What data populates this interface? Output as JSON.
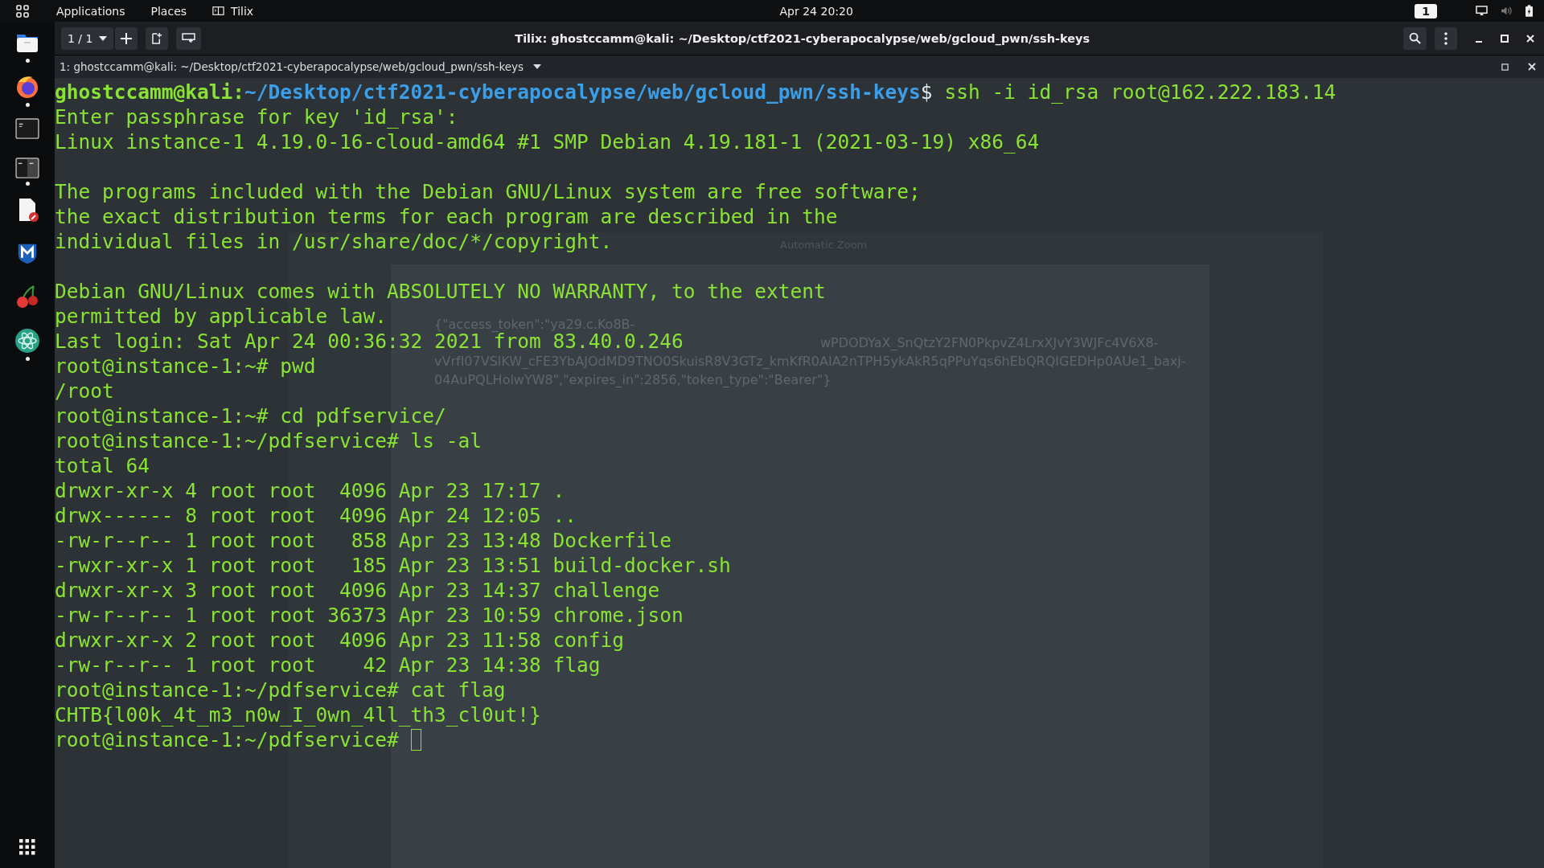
{
  "top_bar": {
    "menus": [
      "Applications",
      "Places",
      "Tilix"
    ],
    "clock": "Apr 24  20:20",
    "workspace": "1"
  },
  "window": {
    "session": "1 / 1",
    "title": "Tilix: ghostccamm@kali: ~/Desktop/ctf2021-cyberapocalypse/web/gcloud_pwn/ssh-keys"
  },
  "tab": {
    "label": "1: ghostccamm@kali: ~/Desktop/ctf2021-cyberapocalypse/web/gcloud_pwn/ssh-keys"
  },
  "background_viewer": {
    "zoom": "Automatic Zoom",
    "lines": [
      {
        "text": "{\"access_token\":\"ya29.c.Ko8B-"
      },
      {
        "text": "wPDODYaX_SnQtzY2FN0PkpvZ4LrxXJvY3WJFc4V6X8-"
      },
      {
        "text": "vVrfI07VSlKW_cFE3YbAJOdMD9TNO0SkuisR8V3GTz_kmKfR0AIA2nTPH5ykAkR5qPPuYqs6hEbQRQIGEDHp0AUe1_baxj-"
      },
      {
        "text": "04AuPQLHolwYW8\",\"expires_in\":2856,\"token_type\":\"Bearer\"}"
      }
    ]
  },
  "terminal": {
    "lines": [
      {
        "kind": "host_prompt",
        "user": "ghostccamm@kali:",
        "path": "~/Desktop/ctf2021-cyberapocalypse/web/gcloud_pwn/ssh-keys",
        "symbol": "$",
        "command": "ssh -i id_rsa root@162.222.183.14"
      },
      {
        "kind": "output",
        "text": "Enter passphrase for key 'id_rsa':"
      },
      {
        "kind": "output",
        "text": "Linux instance-1 4.19.0-16-cloud-amd64 #1 SMP Debian 4.19.181-1 (2021-03-19) x86_64"
      },
      {
        "kind": "blank"
      },
      {
        "kind": "output",
        "text": "The programs included with the Debian GNU/Linux system are free software;"
      },
      {
        "kind": "output",
        "text": "the exact distribution terms for each program are described in the"
      },
      {
        "kind": "output",
        "text": "individual files in /usr/share/doc/*/copyright."
      },
      {
        "kind": "blank"
      },
      {
        "kind": "output",
        "text": "Debian GNU/Linux comes with ABSOLUTELY NO WARRANTY, to the extent"
      },
      {
        "kind": "output",
        "text": "permitted by applicable law."
      },
      {
        "kind": "output",
        "text": "Last login: Sat Apr 24 00:36:32 2021 from 83.40.0.246"
      },
      {
        "kind": "output",
        "text": "root@instance-1:~# pwd"
      },
      {
        "kind": "output",
        "text": "/root"
      },
      {
        "kind": "output",
        "text": "root@instance-1:~# cd pdfservice/"
      },
      {
        "kind": "output",
        "text": "root@instance-1:~/pdfservice# ls -al"
      },
      {
        "kind": "output",
        "text": "total 64"
      },
      {
        "kind": "output",
        "text": "drwxr-xr-x 4 root root  4096 Apr 23 17:17 ."
      },
      {
        "kind": "output",
        "text": "drwx------ 8 root root  4096 Apr 24 12:05 .."
      },
      {
        "kind": "output",
        "text": "-rw-r--r-- 1 root root   858 Apr 23 13:48 Dockerfile"
      },
      {
        "kind": "output",
        "text": "-rwxr-xr-x 1 root root   185 Apr 23 13:51 build-docker.sh"
      },
      {
        "kind": "output",
        "text": "drwxr-xr-x 3 root root  4096 Apr 23 14:37 challenge"
      },
      {
        "kind": "output",
        "text": "-rw-r--r-- 1 root root 36373 Apr 23 10:59 chrome.json"
      },
      {
        "kind": "output",
        "text": "drwxr-xr-x 2 root root  4096 Apr 23 11:58 config"
      },
      {
        "kind": "output",
        "text": "-rw-r--r-- 1 root root    42 Apr 23 14:38 flag"
      },
      {
        "kind": "output",
        "text": "root@instance-1:~/pdfservice# cat flag"
      },
      {
        "kind": "output",
        "text": "CHTB{l00k_4t_m3_n0w_I_0wn_4ll_th3_cl0ut!}"
      },
      {
        "kind": "output",
        "text": "root@instance-1:~/pdfservice#",
        "cursor": true
      }
    ]
  }
}
